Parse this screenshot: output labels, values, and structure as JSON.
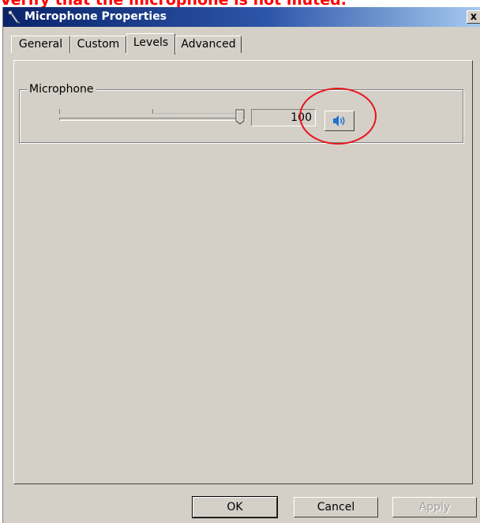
{
  "caption": {
    "text": "Verify that the microphone is not muted."
  },
  "window": {
    "title": "Microphone Properties",
    "close_label": "x",
    "tabs": [
      {
        "label": "General",
        "active": false
      },
      {
        "label": "Custom",
        "active": false
      },
      {
        "label": "Levels",
        "active": true
      },
      {
        "label": "Advanced",
        "active": false
      }
    ]
  },
  "levels": {
    "group_label": "Microphone",
    "level_value": "100",
    "slider_fraction": 1.0,
    "muted": false
  },
  "buttons": {
    "ok": "OK",
    "cancel": "Cancel",
    "apply": "Apply"
  },
  "colors": {
    "caption": "#ff0000",
    "annotation": "#e8141b",
    "speaker": "#1e6fd0",
    "titlebar": "#0a246a"
  },
  "icons": {
    "title": "microphone-icon",
    "mute_toggle": "speaker-icon"
  }
}
